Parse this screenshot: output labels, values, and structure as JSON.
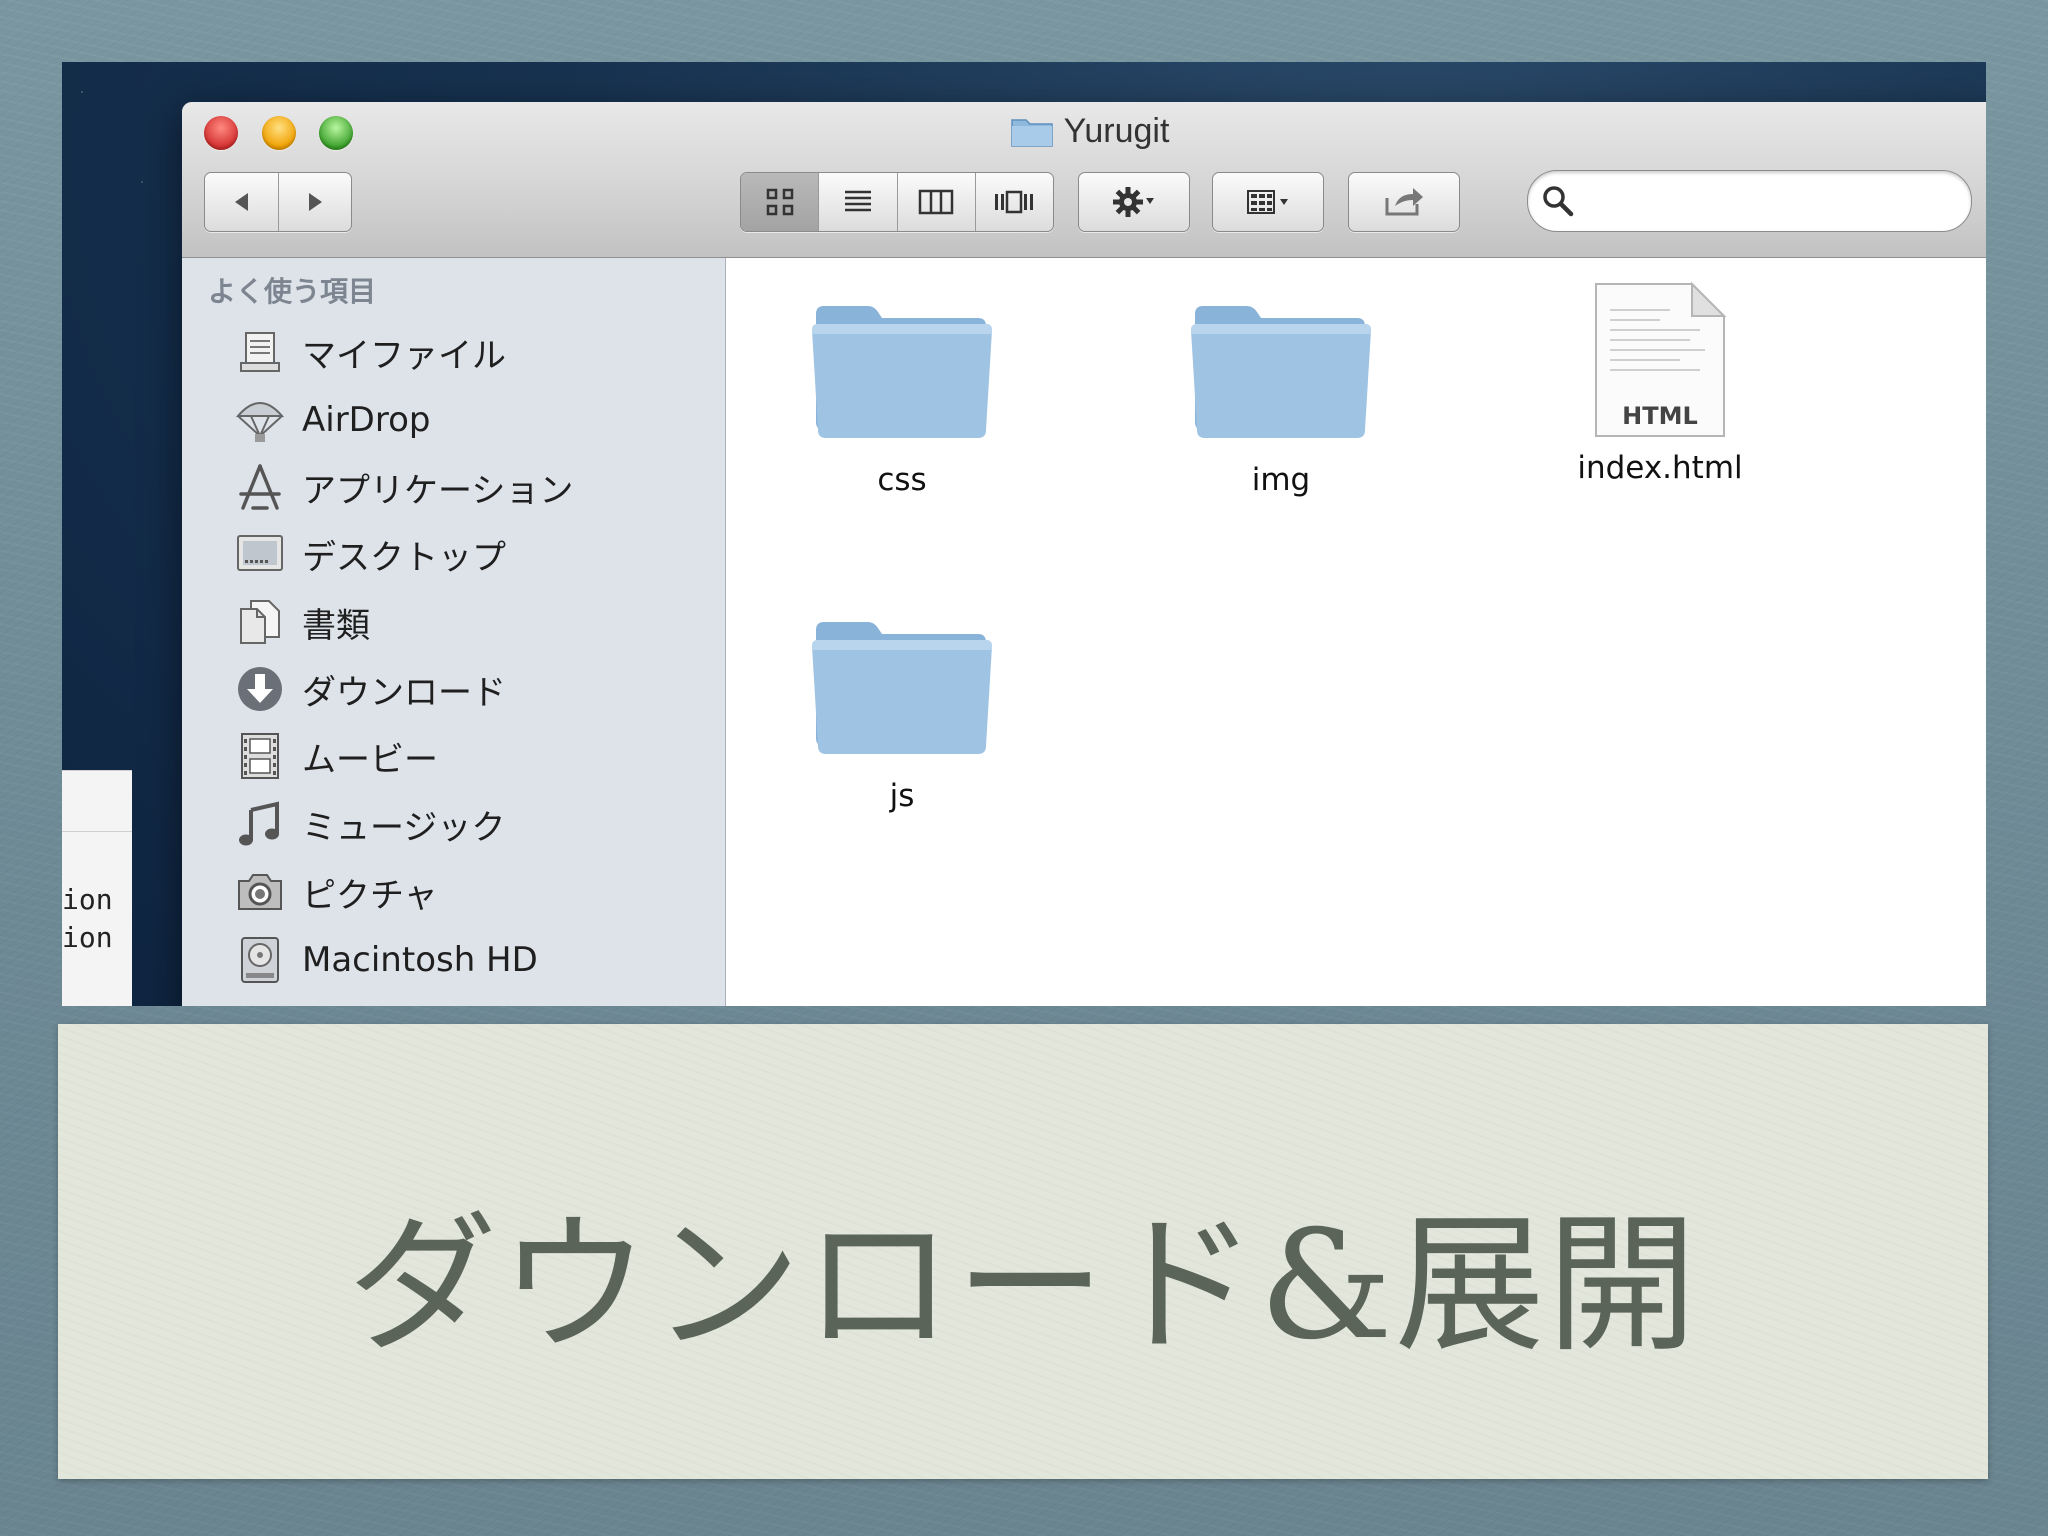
{
  "window": {
    "title": "Yurugit"
  },
  "toolbar": {
    "back_icon": "back-arrow-icon",
    "forward_icon": "forward-arrow-icon",
    "view_modes": [
      "icon-view",
      "list-view",
      "column-view",
      "coverflow-view"
    ],
    "active_view": "icon-view",
    "search": {
      "value": "",
      "placeholder": ""
    }
  },
  "sidebar": {
    "heading": "よく使う項目",
    "items": [
      {
        "label": "マイファイル",
        "icon": "all-my-files-icon"
      },
      {
        "label": "AirDrop",
        "icon": "airdrop-icon"
      },
      {
        "label": "アプリケーション",
        "icon": "applications-icon"
      },
      {
        "label": "デスクトップ",
        "icon": "desktop-icon"
      },
      {
        "label": "書類",
        "icon": "documents-icon"
      },
      {
        "label": "ダウンロード",
        "icon": "downloads-icon"
      },
      {
        "label": "ムービー",
        "icon": "movies-icon"
      },
      {
        "label": "ミュージック",
        "icon": "music-icon"
      },
      {
        "label": "ピクチャ",
        "icon": "pictures-icon"
      },
      {
        "label": "Macintosh HD",
        "icon": "hard-drive-icon"
      }
    ]
  },
  "files": [
    {
      "name": "css",
      "kind": "folder"
    },
    {
      "name": "img",
      "kind": "folder"
    },
    {
      "name": "index.html",
      "kind": "html",
      "badge": "HTML"
    },
    {
      "name": "js",
      "kind": "folder"
    }
  ],
  "background_window": {
    "lines": [
      "ion",
      "ion"
    ]
  },
  "caption": {
    "text": "ダウンロード&展開"
  },
  "colors": {
    "folder": "#9ec3e3",
    "caption_bg": "#e3e6da",
    "caption_text": "#5a6458",
    "sidebar_bg": "#dee3ea"
  }
}
